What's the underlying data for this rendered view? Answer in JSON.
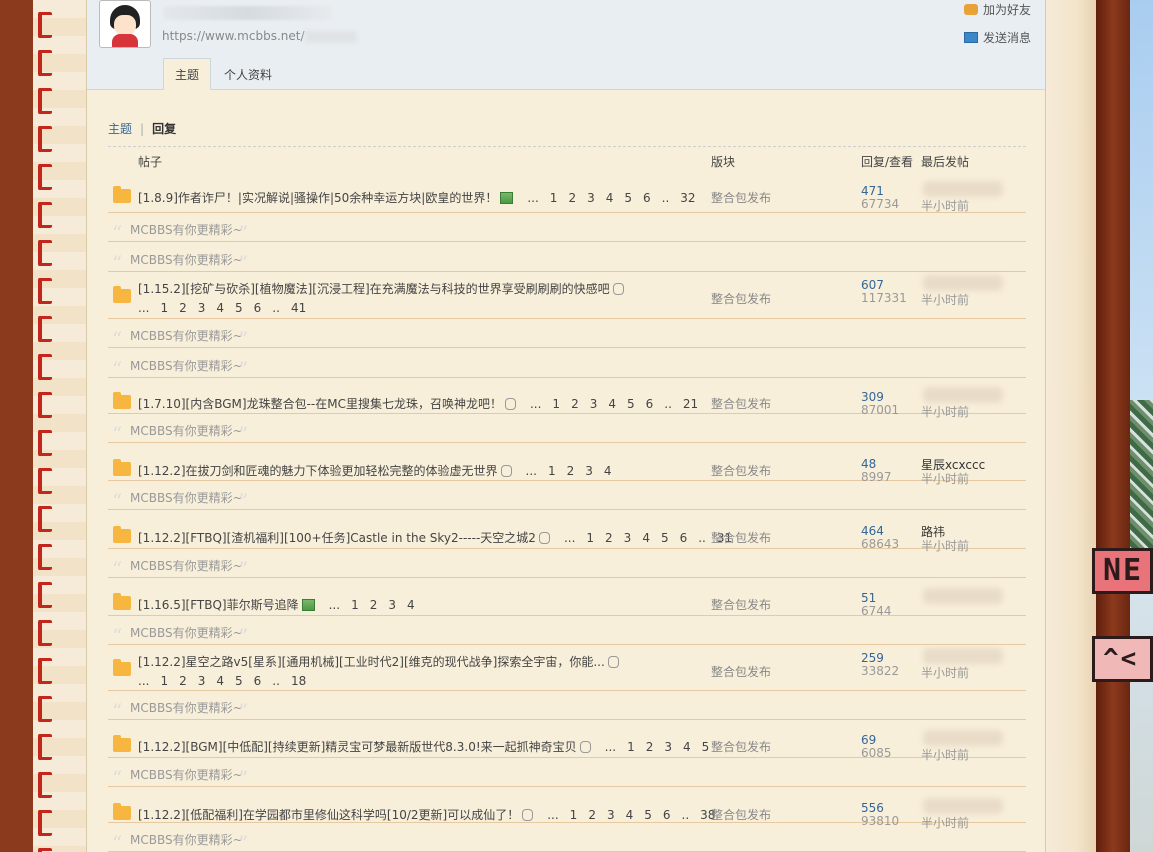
{
  "profile": {
    "url": "https://www.mcbbs.net/",
    "add_friend": "加为好友",
    "send_message": "发送消息"
  },
  "tabs": [
    {
      "label": "主题",
      "active": true
    },
    {
      "label": "个人资料",
      "active": false
    }
  ],
  "subnav": {
    "topics": "主题",
    "replies": "回复"
  },
  "table_header": {
    "post": "帖子",
    "forum": "版块",
    "reply_view": "回复/查看",
    "last_post": "最后发帖"
  },
  "promo_text": "MCBBS有你更精彩~",
  "threads": [
    {
      "title": "[1.8.9]作者诈尸！|实况解说|骚操作|50余种幸运方块|欧皇的世界！",
      "icon": "image",
      "pages": [
        "...",
        "1",
        "2",
        "3",
        "4",
        "5",
        "6",
        "..",
        "32"
      ],
      "forum": "整合包发布",
      "replies": "471",
      "views": "67734",
      "last_poster": "",
      "last_time": "半小时前"
    },
    {
      "title": "[1.15.2][挖矿与砍杀][植物魔法][沉浸工程]在充满魔法与科技的世界享受刷刷刷的快感吧",
      "icon": "attachment",
      "pages": [
        "...",
        "1",
        "2",
        "3",
        "4",
        "5",
        "6",
        "..",
        "41"
      ],
      "forum": "整合包发布",
      "replies": "607",
      "views": "117331",
      "last_poster": "",
      "last_time": "半小时前"
    },
    {
      "title": "[1.7.10][内含BGM]龙珠整合包--在MC里搜集七龙珠，召唤神龙吧！",
      "icon": "attachment",
      "pages": [
        "...",
        "1",
        "2",
        "3",
        "4",
        "5",
        "6",
        "..",
        "21"
      ],
      "forum": "整合包发布",
      "replies": "309",
      "views": "87001",
      "last_poster": "",
      "last_time": "半小时前"
    },
    {
      "title": "[1.12.2]在拔刀剑和匠魂的魅力下体验更加轻松完整的体验虚无世界",
      "icon": "attachment",
      "pages": [
        "...",
        "1",
        "2",
        "3",
        "4"
      ],
      "forum": "整合包发布",
      "replies": "48",
      "views": "8997",
      "last_poster": "星辰xcxccc",
      "last_time": "半小时前"
    },
    {
      "title": "[1.12.2][FTBQ][渣机福利][100+任务]Castle in the Sky2-----天空之城2",
      "icon": "attachment",
      "pages": [
        "...",
        "1",
        "2",
        "3",
        "4",
        "5",
        "6",
        "..",
        "31"
      ],
      "forum": "整合包发布",
      "replies": "464",
      "views": "68643",
      "last_poster": "路祎",
      "last_time": "半小时前"
    },
    {
      "title": "[1.16.5][FTBQ]菲尔斯号追降",
      "icon": "image",
      "pages": [
        "...",
        "1",
        "2",
        "3",
        "4"
      ],
      "forum": "整合包发布",
      "replies": "51",
      "views": "6744",
      "last_poster": "",
      "last_time": ""
    },
    {
      "title": "[1.12.2]星空之路v5[星系][通用机械][工业时代2][维克的现代战争]探索全宇宙，你能...",
      "icon": "attachment",
      "pages": [
        "...",
        "1",
        "2",
        "3",
        "4",
        "5",
        "6",
        "..",
        "18"
      ],
      "forum": "整合包发布",
      "replies": "259",
      "views": "33822",
      "last_poster": "",
      "last_time": "半小时前"
    },
    {
      "title": "[1.12.2][BGM][中低配][持续更新]精灵宝可梦最新版世代8.3.0!来一起抓神奇宝贝",
      "icon": "attachment",
      "pages": [
        "...",
        "1",
        "2",
        "3",
        "4",
        "5"
      ],
      "forum": "整合包发布",
      "replies": "69",
      "views": "6085",
      "last_poster": "",
      "last_time": "半小时前"
    },
    {
      "title": "[1.12.2][低配福利]在学园都市里修仙这科学吗[10/2更新]可以成仙了！",
      "icon": "attachment",
      "pages": [
        "...",
        "1",
        "2",
        "3",
        "4",
        "5",
        "6",
        "..",
        "38"
      ],
      "forum": "整合包发布",
      "replies": "556",
      "views": "93810",
      "last_poster": "",
      "last_time": "半小时前"
    }
  ],
  "side_banners": [
    "NE",
    "^<"
  ]
}
